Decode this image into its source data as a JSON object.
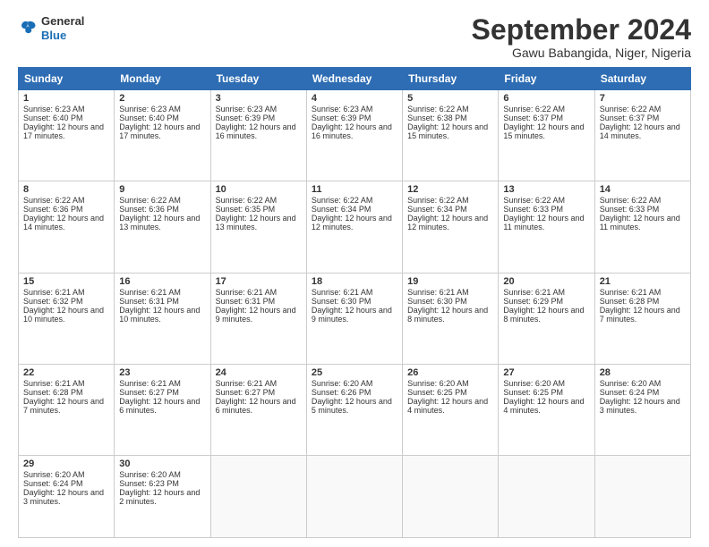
{
  "logo": {
    "line1": "General",
    "line2": "Blue"
  },
  "header": {
    "month": "September 2024",
    "location": "Gawu Babangida, Niger, Nigeria"
  },
  "days": [
    "Sunday",
    "Monday",
    "Tuesday",
    "Wednesday",
    "Thursday",
    "Friday",
    "Saturday"
  ],
  "weeks": [
    [
      {
        "day": "1",
        "sunrise": "6:23 AM",
        "sunset": "6:40 PM",
        "daylight": "12 hours and 17 minutes."
      },
      {
        "day": "2",
        "sunrise": "6:23 AM",
        "sunset": "6:40 PM",
        "daylight": "12 hours and 17 minutes."
      },
      {
        "day": "3",
        "sunrise": "6:23 AM",
        "sunset": "6:39 PM",
        "daylight": "12 hours and 16 minutes."
      },
      {
        "day": "4",
        "sunrise": "6:23 AM",
        "sunset": "6:39 PM",
        "daylight": "12 hours and 16 minutes."
      },
      {
        "day": "5",
        "sunrise": "6:22 AM",
        "sunset": "6:38 PM",
        "daylight": "12 hours and 15 minutes."
      },
      {
        "day": "6",
        "sunrise": "6:22 AM",
        "sunset": "6:37 PM",
        "daylight": "12 hours and 15 minutes."
      },
      {
        "day": "7",
        "sunrise": "6:22 AM",
        "sunset": "6:37 PM",
        "daylight": "12 hours and 14 minutes."
      }
    ],
    [
      {
        "day": "8",
        "sunrise": "6:22 AM",
        "sunset": "6:36 PM",
        "daylight": "12 hours and 14 minutes."
      },
      {
        "day": "9",
        "sunrise": "6:22 AM",
        "sunset": "6:36 PM",
        "daylight": "12 hours and 13 minutes."
      },
      {
        "day": "10",
        "sunrise": "6:22 AM",
        "sunset": "6:35 PM",
        "daylight": "12 hours and 13 minutes."
      },
      {
        "day": "11",
        "sunrise": "6:22 AM",
        "sunset": "6:34 PM",
        "daylight": "12 hours and 12 minutes."
      },
      {
        "day": "12",
        "sunrise": "6:22 AM",
        "sunset": "6:34 PM",
        "daylight": "12 hours and 12 minutes."
      },
      {
        "day": "13",
        "sunrise": "6:22 AM",
        "sunset": "6:33 PM",
        "daylight": "12 hours and 11 minutes."
      },
      {
        "day": "14",
        "sunrise": "6:22 AM",
        "sunset": "6:33 PM",
        "daylight": "12 hours and 11 minutes."
      }
    ],
    [
      {
        "day": "15",
        "sunrise": "6:21 AM",
        "sunset": "6:32 PM",
        "daylight": "12 hours and 10 minutes."
      },
      {
        "day": "16",
        "sunrise": "6:21 AM",
        "sunset": "6:31 PM",
        "daylight": "12 hours and 10 minutes."
      },
      {
        "day": "17",
        "sunrise": "6:21 AM",
        "sunset": "6:31 PM",
        "daylight": "12 hours and 9 minutes."
      },
      {
        "day": "18",
        "sunrise": "6:21 AM",
        "sunset": "6:30 PM",
        "daylight": "12 hours and 9 minutes."
      },
      {
        "day": "19",
        "sunrise": "6:21 AM",
        "sunset": "6:30 PM",
        "daylight": "12 hours and 8 minutes."
      },
      {
        "day": "20",
        "sunrise": "6:21 AM",
        "sunset": "6:29 PM",
        "daylight": "12 hours and 8 minutes."
      },
      {
        "day": "21",
        "sunrise": "6:21 AM",
        "sunset": "6:28 PM",
        "daylight": "12 hours and 7 minutes."
      }
    ],
    [
      {
        "day": "22",
        "sunrise": "6:21 AM",
        "sunset": "6:28 PM",
        "daylight": "12 hours and 7 minutes."
      },
      {
        "day": "23",
        "sunrise": "6:21 AM",
        "sunset": "6:27 PM",
        "daylight": "12 hours and 6 minutes."
      },
      {
        "day": "24",
        "sunrise": "6:21 AM",
        "sunset": "6:27 PM",
        "daylight": "12 hours and 6 minutes."
      },
      {
        "day": "25",
        "sunrise": "6:20 AM",
        "sunset": "6:26 PM",
        "daylight": "12 hours and 5 minutes."
      },
      {
        "day": "26",
        "sunrise": "6:20 AM",
        "sunset": "6:25 PM",
        "daylight": "12 hours and 4 minutes."
      },
      {
        "day": "27",
        "sunrise": "6:20 AM",
        "sunset": "6:25 PM",
        "daylight": "12 hours and 4 minutes."
      },
      {
        "day": "28",
        "sunrise": "6:20 AM",
        "sunset": "6:24 PM",
        "daylight": "12 hours and 3 minutes."
      }
    ],
    [
      {
        "day": "29",
        "sunrise": "6:20 AM",
        "sunset": "6:24 PM",
        "daylight": "12 hours and 3 minutes."
      },
      {
        "day": "30",
        "sunrise": "6:20 AM",
        "sunset": "6:23 PM",
        "daylight": "12 hours and 2 minutes."
      },
      null,
      null,
      null,
      null,
      null
    ]
  ]
}
